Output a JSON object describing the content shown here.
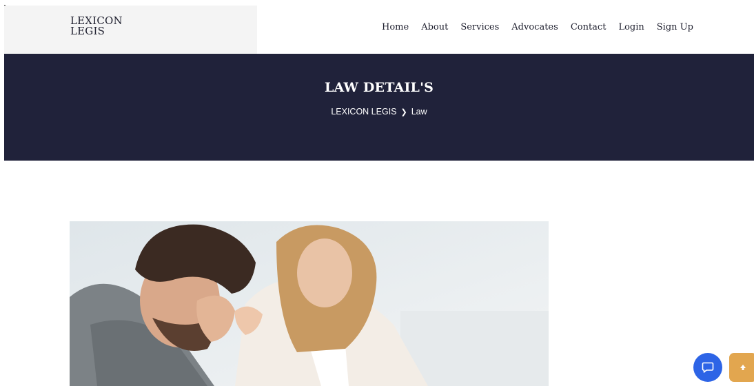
{
  "brand": {
    "line1": "LEXICON",
    "line2": "LEGIS"
  },
  "nav": {
    "items": [
      {
        "label": "Home"
      },
      {
        "label": "About"
      },
      {
        "label": "Services"
      },
      {
        "label": "Advocates"
      },
      {
        "label": "Contact"
      },
      {
        "label": "Login"
      },
      {
        "label": "Sign Up"
      }
    ]
  },
  "hero": {
    "title": "LAW DETAIL'S",
    "breadcrumb": {
      "home": "LEXICON LEGIS",
      "separator": "❯",
      "current": "Law"
    }
  },
  "photo": {
    "icon": "law-consultation-photo"
  },
  "floating": {
    "chat_icon": "chat-bubble-icon",
    "top_icon": "arrow-up-icon",
    "chat_color": "#2d64e6",
    "top_color": "#e2a64f"
  },
  "colors": {
    "hero_bg": "#20223a",
    "logo_bg": "#f4f4f4"
  }
}
